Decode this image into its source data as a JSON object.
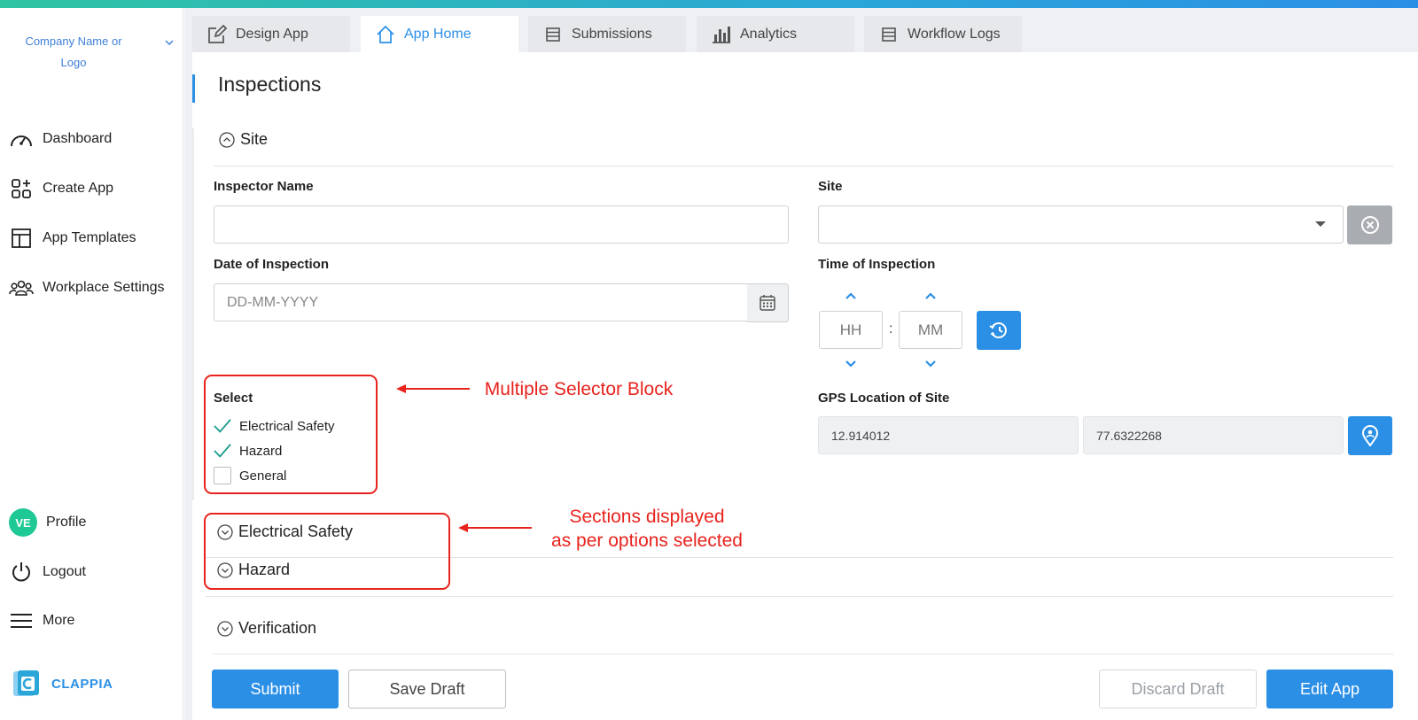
{
  "sidebar": {
    "company": "Company Name or Logo",
    "nav": [
      {
        "label": "Dashboard",
        "icon": "dashboard-icon"
      },
      {
        "label": "Create App",
        "icon": "create-app-icon"
      },
      {
        "label": "App Templates",
        "icon": "templates-icon"
      },
      {
        "label": "Workplace Settings",
        "icon": "team-icon"
      }
    ],
    "profile": {
      "initials": "VE",
      "label": "Profile"
    },
    "logout": "Logout",
    "more": "More",
    "brand": "CLAPPIA"
  },
  "tabs": [
    {
      "label": "Design App",
      "icon": "edit-icon",
      "active": false
    },
    {
      "label": "App Home",
      "icon": "home-icon",
      "active": true
    },
    {
      "label": "Submissions",
      "icon": "list-icon",
      "active": false
    },
    {
      "label": "Analytics",
      "icon": "bar-chart-icon",
      "active": false
    },
    {
      "label": "Workflow Logs",
      "icon": "list-icon",
      "active": false
    }
  ],
  "page": {
    "title": "Inspections",
    "section_site": "Site",
    "fields": {
      "inspector_name": {
        "label": "Inspector Name",
        "value": ""
      },
      "site": {
        "label": "Site",
        "value": ""
      },
      "date": {
        "label": "Date of Inspection",
        "placeholder": "DD-MM-YYYY"
      },
      "time": {
        "label": "Time of Inspection",
        "hh": "HH",
        "mm": "MM",
        "separator": ":"
      },
      "gps": {
        "label": "GPS Location of Site",
        "lat": "12.914012",
        "lng": "77.6322268"
      }
    },
    "select": {
      "label": "Select",
      "options": [
        {
          "label": "Electrical Safety",
          "checked": true
        },
        {
          "label": "Hazard",
          "checked": true
        },
        {
          "label": "General",
          "checked": false
        }
      ]
    },
    "sections": [
      "Electrical Safety",
      "Hazard",
      "Verification"
    ],
    "annotations": {
      "multi": "Multiple Selector Block",
      "sections_line1": "Sections displayed",
      "sections_line2": "as per options selected"
    },
    "buttons": {
      "submit": "Submit",
      "save_draft": "Save Draft",
      "discard_draft": "Discard Draft",
      "edit_app": "Edit App"
    }
  },
  "colors": {
    "accent": "#2b8fe6",
    "annotation": "#e8231d",
    "check": "#1a9c8a",
    "avatar": "#1fc995"
  }
}
